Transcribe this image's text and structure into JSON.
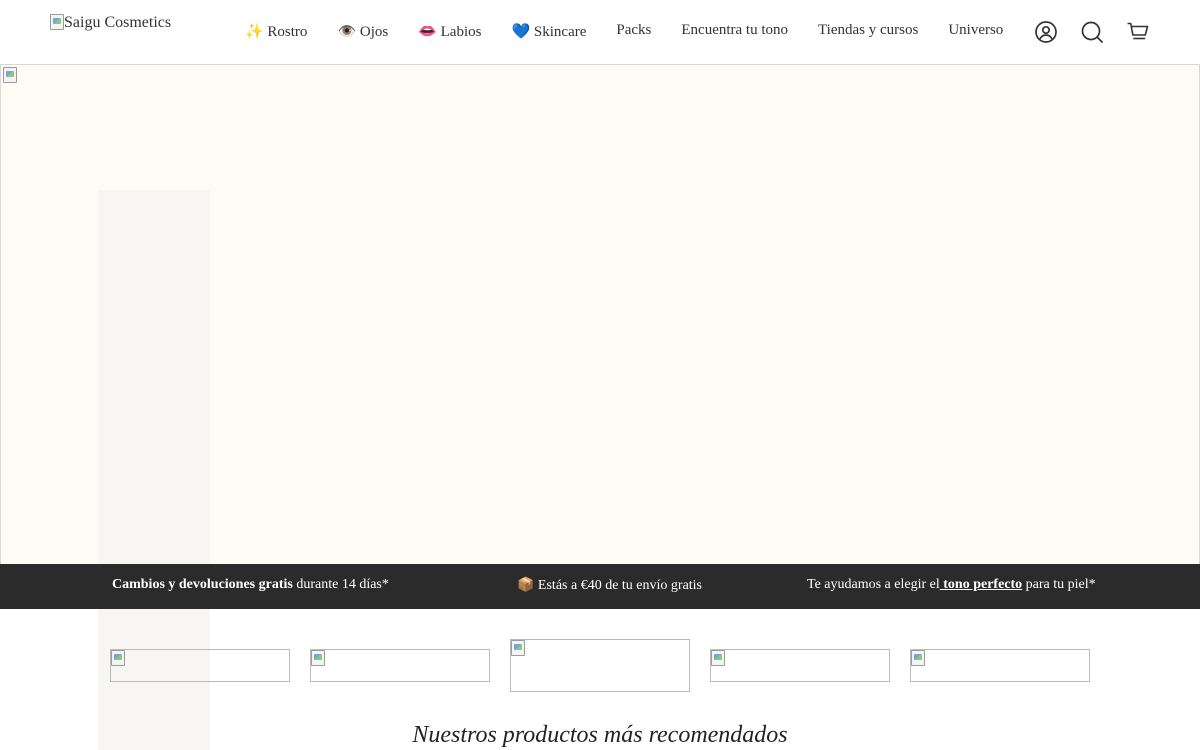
{
  "header": {
    "logo_alt": "Saigu Cosmetics",
    "nav": [
      {
        "label": "✨ Rostro",
        "icon": "sparkles-icon"
      },
      {
        "label": "👁️ Ojos",
        "icon": "eye-icon"
      },
      {
        "label": "👄 Labios",
        "icon": "lips-icon"
      },
      {
        "label": "💙 Skincare",
        "icon": "blue-heart-icon"
      },
      {
        "label": "Packs"
      },
      {
        "label": "Encuentra tu tono"
      },
      {
        "label": "Tiendas y cursos"
      },
      {
        "label": "Universo"
      }
    ],
    "icons": [
      "account-icon",
      "search-icon",
      "cart-icon"
    ]
  },
  "banner": {
    "msg1_bold": "Cambios y devoluciones gratis",
    "msg1_rest": " durante 14 días*",
    "msg2": "📦 Estás a €40 de tu envío gratis",
    "msg3_start": "Te ayudamos a elegir el",
    "msg3_link": " tono perfecto",
    "msg3_end": " para tu piel*"
  },
  "section_title": "Nuestros productos más recomendados"
}
